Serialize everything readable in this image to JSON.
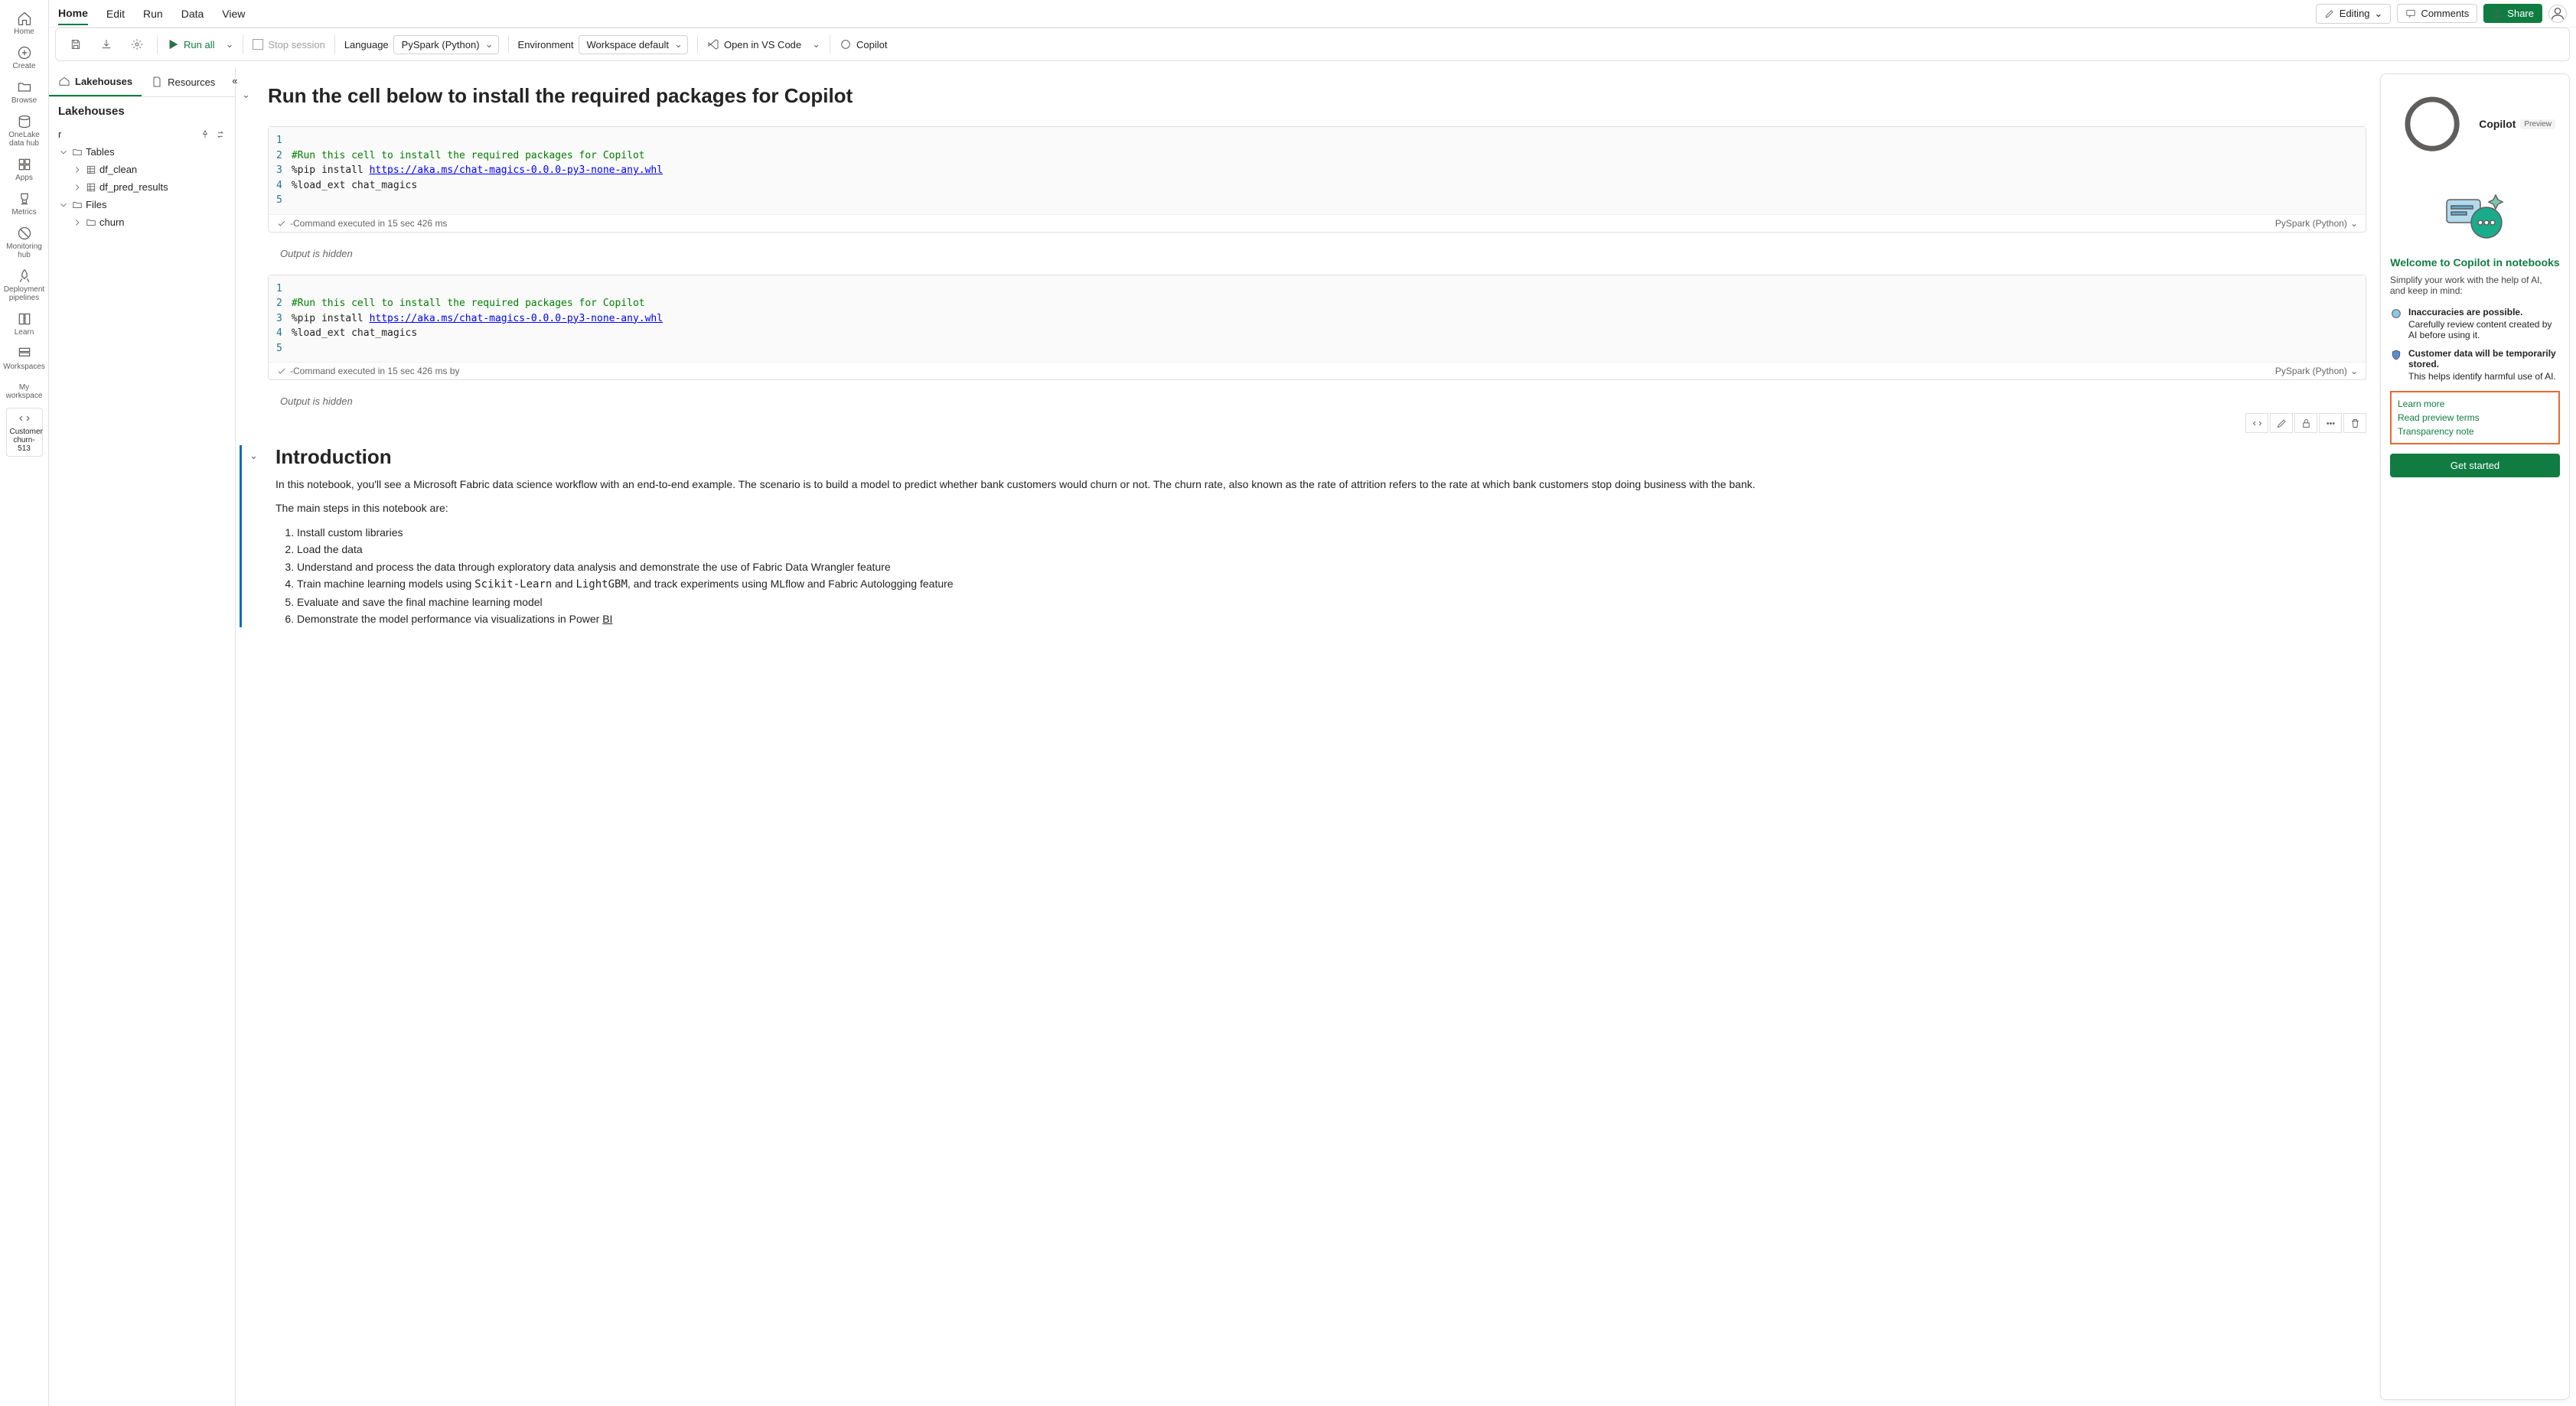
{
  "rail": [
    {
      "icon": "home",
      "label": "Home"
    },
    {
      "icon": "plus",
      "label": "Create"
    },
    {
      "icon": "folder",
      "label": "Browse"
    },
    {
      "icon": "onelake",
      "label": "OneLake data hub"
    },
    {
      "icon": "apps",
      "label": "Apps"
    },
    {
      "icon": "metrics",
      "label": "Metrics"
    },
    {
      "icon": "monitor",
      "label": "Monitoring hub"
    },
    {
      "icon": "deploy",
      "label": "Deployment pipelines"
    },
    {
      "icon": "learn",
      "label": "Learn"
    },
    {
      "icon": "workspaces",
      "label": "Workspaces"
    }
  ],
  "rail_ws_top": "My workspace",
  "rail_ws": {
    "label": "Customer churn-513"
  },
  "menu": {
    "tabs": [
      "Home",
      "Edit",
      "Run",
      "Data",
      "View"
    ],
    "editing": "Editing",
    "comments": "Comments",
    "share": "Share"
  },
  "toolbar": {
    "run_all": "Run all",
    "stop": "Stop session",
    "language_label": "Language",
    "language_value": "PySpark (Python)",
    "env_label": "Environment",
    "env_value": "Workspace default",
    "vscode": "Open in VS Code",
    "copilot": "Copilot"
  },
  "explorer": {
    "tabs": {
      "t1": "Lakehouses",
      "t2": "Resources"
    },
    "title": "Lakehouses",
    "current": "r",
    "nodes": {
      "tables": "Tables",
      "t_df_clean": "df_clean",
      "t_df_pred": "df_pred_results",
      "files": "Files",
      "f_churn": "churn"
    }
  },
  "notebook": {
    "h1": "Run the cell below to install the required packages for Copilot",
    "code": {
      "l2": "#Run this cell to install the required packages for Copilot",
      "l3a": "%pip install ",
      "l3b": "https://aka.ms/chat-magics-0.0.0-py3-none-any.whl",
      "l4": "%load_ext chat_magics"
    },
    "status1": "-Command executed in 15 sec 426 ms",
    "status2": "-Command executed in 15 sec 426 ms by",
    "lang": "PySpark (Python)",
    "hidden": "Output is hidden",
    "intro_h": "Introduction",
    "intro_p": "In this notebook, you'll see a Microsoft Fabric data science workflow with an end-to-end example. The scenario is to build a model to predict whether bank customers would churn or not. The churn rate, also known as the rate of attrition refers to the rate at which bank customers stop doing business with the bank.",
    "steps_intro": "The main steps in this notebook are:",
    "steps": [
      "Install custom libraries",
      "Load the data",
      "Understand and process the data through exploratory data analysis and demonstrate the use of Fabric Data Wrangler feature",
      "Train machine learning models using Scikit-Learn and LightGBM, and track experiments using MLflow and Fabric Autologging feature",
      "Evaluate and save the final machine learning model",
      "Demonstrate the model performance via visualizations in Power BI"
    ]
  },
  "copilot": {
    "title": "Copilot",
    "badge": "Preview",
    "welcome": "Welcome to Copilot in notebooks",
    "sub": "Simplify your work with the help of AI, and keep in mind:",
    "p1_t": "Inaccuracies are possible.",
    "p1_b": "Carefully review content created by AI before using it.",
    "p2_t": "Customer data will be temporarily stored.",
    "p2_b": "This helps identify harmful use of AI.",
    "links": [
      "Learn more",
      "Read preview terms",
      "Transparency note"
    ],
    "cta": "Get started"
  }
}
